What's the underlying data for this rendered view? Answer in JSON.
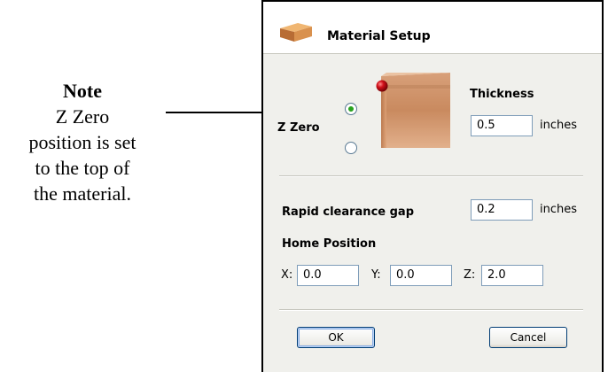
{
  "note": {
    "title": "Note",
    "lines": [
      "Z Zero",
      "position is set",
      "to the top of",
      "the material."
    ]
  },
  "dialog": {
    "title": "Material Setup",
    "icon": "material-block-icon",
    "z_zero_label": "Z Zero",
    "z_zero_options": [
      {
        "name": "top",
        "selected": true
      },
      {
        "name": "bottom",
        "selected": false
      }
    ],
    "thickness": {
      "label": "Thickness",
      "value": "0.5",
      "unit": "inches"
    },
    "rapid_gap": {
      "label": "Rapid clearance gap",
      "value": "0.2",
      "unit": "inches"
    },
    "home": {
      "label": "Home Position",
      "x_label": "X:",
      "x": "0.0",
      "y_label": "Y:",
      "y": "0.0",
      "z_label": "Z:",
      "z": "2.0"
    },
    "ok_label": "OK",
    "cancel_label": "Cancel"
  },
  "colors": {
    "radio_selected": "#29a31f",
    "zero_marker": "#c0141c",
    "material": "#c98a5a"
  }
}
